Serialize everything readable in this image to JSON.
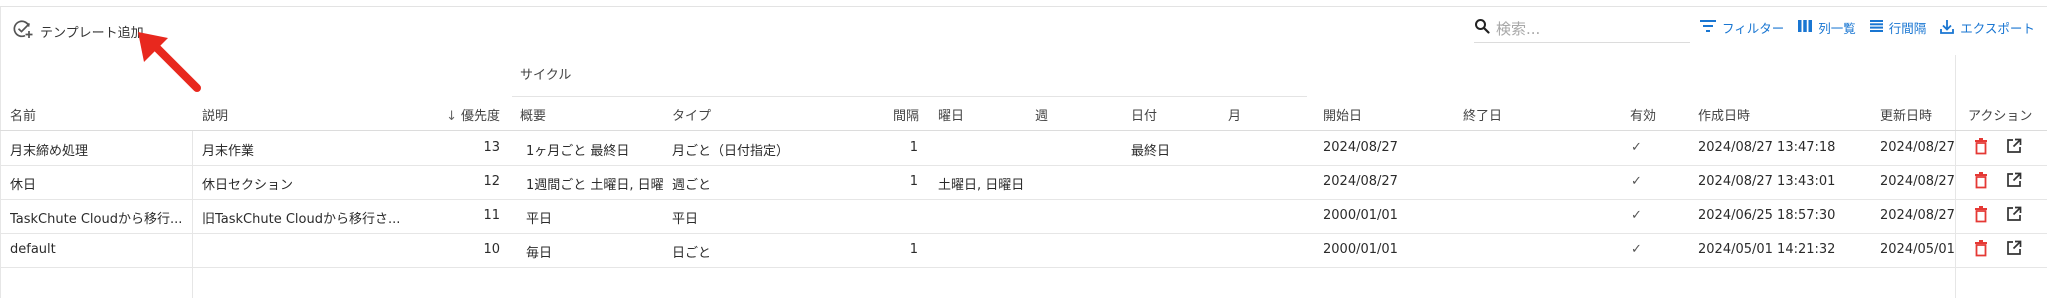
{
  "toolbar": {
    "add_template_label": "テンプレート追加",
    "search_placeholder": "検索...",
    "filter_label": "フィルター",
    "columns_label": "列一覧",
    "density_label": "行間隔",
    "export_label": "エクスポート"
  },
  "colors": {
    "accent": "#1976d2",
    "danger": "#e53935",
    "arrow": "#e8281e"
  },
  "table": {
    "group_header": "サイクル",
    "columns": {
      "name": "名前",
      "description": "説明",
      "priority": "優先度",
      "summary": "概要",
      "type": "タイプ",
      "interval": "間隔",
      "weekday": "曜日",
      "week": "週",
      "day": "日付",
      "month": "月",
      "start_date": "開始日",
      "end_date": "終了日",
      "enabled": "有効",
      "created_at": "作成日時",
      "updated_at": "更新日時",
      "actions": "アクション"
    },
    "sort_indicator": "↓",
    "rows": [
      {
        "name": "月末締め処理",
        "description": "月末作業",
        "priority": "13",
        "summary": "1ヶ月ごと 最終日",
        "type": "月ごと（日付指定）",
        "interval": "1",
        "weekday": "",
        "week": "",
        "day": "最終日",
        "month": "",
        "start_date": "2024/08/27",
        "end_date": "",
        "enabled": "✓",
        "created_at": "2024/08/27 13:47:18",
        "updated_at": "2024/08/27"
      },
      {
        "name": "休日",
        "description": "休日セクション",
        "priority": "12",
        "summary": "1週間ごと 土曜日, 日曜",
        "type": "週ごと",
        "interval": "1",
        "weekday": "土曜日, 日曜日",
        "week": "",
        "day": "",
        "month": "",
        "start_date": "2024/08/27",
        "end_date": "",
        "enabled": "✓",
        "created_at": "2024/08/27 13:43:01",
        "updated_at": "2024/08/27"
      },
      {
        "name": "TaskChute Cloudから移行...",
        "description": "旧TaskChute Cloudから移行さ...",
        "priority": "11",
        "summary": "平日",
        "type": "平日",
        "interval": "",
        "weekday": "",
        "week": "",
        "day": "",
        "month": "",
        "start_date": "2000/01/01",
        "end_date": "",
        "enabled": "✓",
        "created_at": "2024/06/25 18:57:30",
        "updated_at": "2024/08/27"
      },
      {
        "name": "default",
        "description": "",
        "priority": "10",
        "summary": "毎日",
        "type": "日ごと",
        "interval": "1",
        "weekday": "",
        "week": "",
        "day": "",
        "month": "",
        "start_date": "2000/01/01",
        "end_date": "",
        "enabled": "✓",
        "created_at": "2024/05/01 14:21:32",
        "updated_at": "2024/05/01"
      }
    ]
  }
}
